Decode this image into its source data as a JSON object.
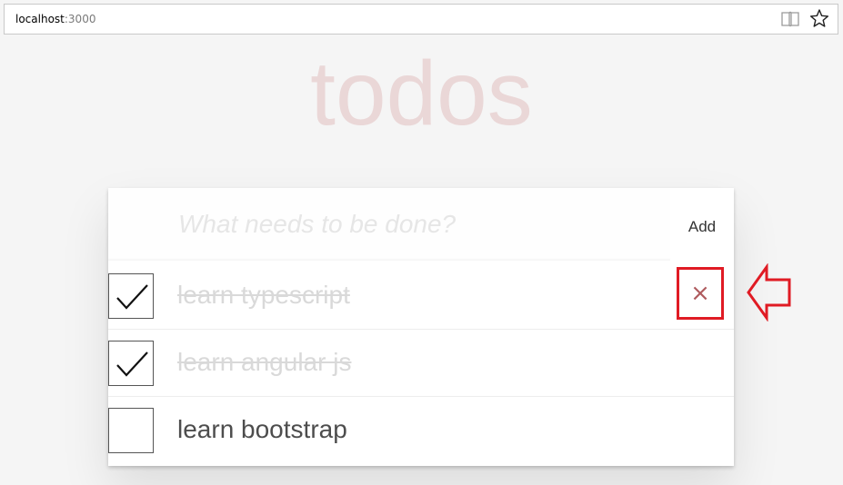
{
  "browser": {
    "url_host": "localhost",
    "url_port": ":3000",
    "icons": [
      "reading-view-icon",
      "favorite-star-icon"
    ]
  },
  "app": {
    "title": "todos",
    "new_todo_placeholder": "What needs to be done?",
    "add_label": "Add",
    "destroy_glyph": "×",
    "todos": [
      {
        "label": "learn typescript",
        "completed": true
      },
      {
        "label": "learn angular js",
        "completed": true
      },
      {
        "label": "learn bootstrap",
        "completed": false
      }
    ]
  },
  "annotations": {
    "highlight_color": "#e01b24",
    "arrow": "left-arrow-outline"
  },
  "colors": {
    "title": "#efd5d5",
    "completed_text": "#d9d9d9",
    "active_text": "#4d4d4d",
    "destroy_x": "#af5b5e"
  }
}
